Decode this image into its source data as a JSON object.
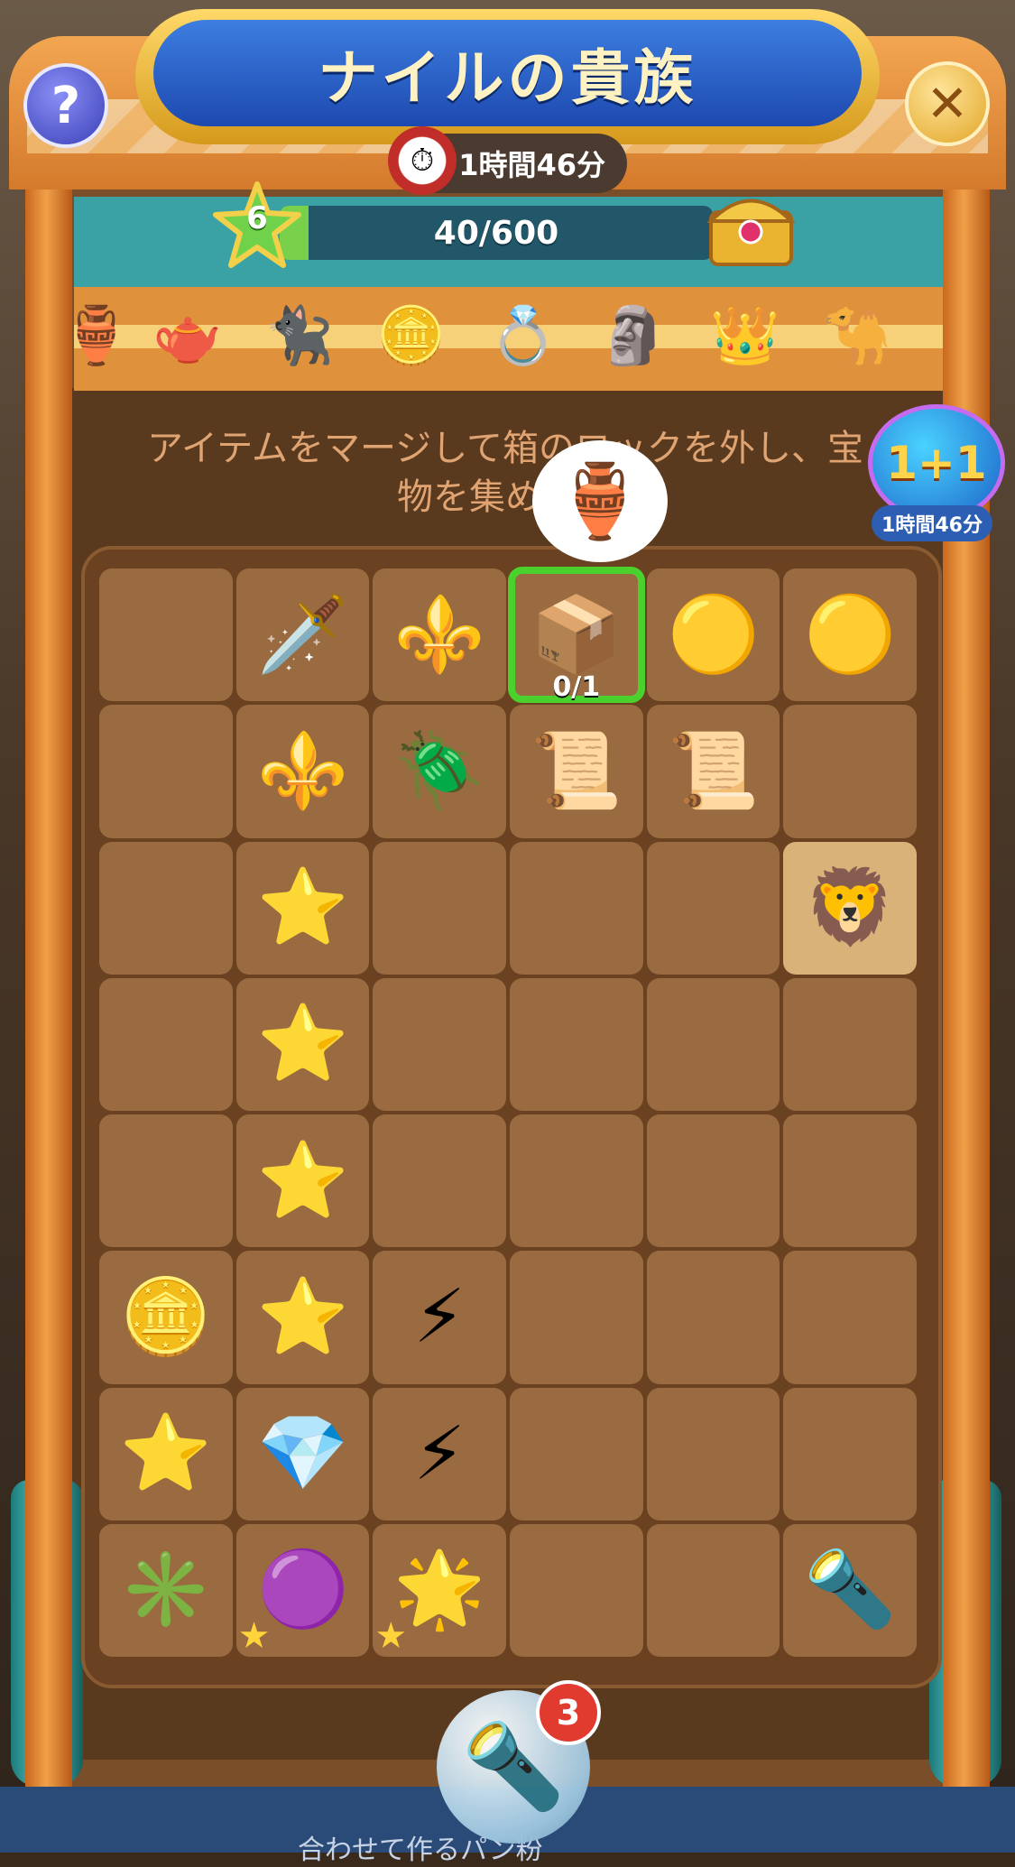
{
  "title": "ナイルの貴族",
  "timer": "1時間46分",
  "level": "6",
  "progress": {
    "text": "40/600",
    "current": 40,
    "max": 600
  },
  "instruction": "アイテムをマージして箱のロックを外し、宝物を集めよう",
  "badge": {
    "label": "1+1",
    "timer": "1時間46分"
  },
  "rewards": [
    "🏺",
    "🫖",
    "🐈‍⬛",
    "🪙",
    "💍",
    "🗿",
    "👑",
    "🐪"
  ],
  "board": [
    [
      "",
      "🗡️",
      "⚜️",
      "📦",
      "🟡",
      "🟡"
    ],
    [
      "",
      "⚜️",
      "🪲",
      "📜",
      "📜",
      ""
    ],
    [
      "",
      "⭐",
      "",
      "",
      "",
      "🦁"
    ],
    [
      "",
      "⭐",
      "",
      "",
      "",
      ""
    ],
    [
      "",
      "⭐",
      "",
      "",
      "",
      ""
    ],
    [
      "🪙",
      "⭐",
      "⚡",
      "",
      "",
      ""
    ],
    [
      "⭐",
      "💎",
      "⚡",
      "",
      "",
      ""
    ],
    [
      "✳️",
      "🟣",
      "🌟",
      "",
      "",
      "🔦"
    ]
  ],
  "chest_counter": "0/1",
  "thought_item": "🏺",
  "bottom_item": {
    "icon": "🔦",
    "count": "3"
  },
  "footer_text": "合わせて作るパン粉",
  "colors": {
    "accent": "#1d49b0",
    "frame": "#7a4e28",
    "cell": "#9a6a40",
    "select": "#4ad12e"
  }
}
